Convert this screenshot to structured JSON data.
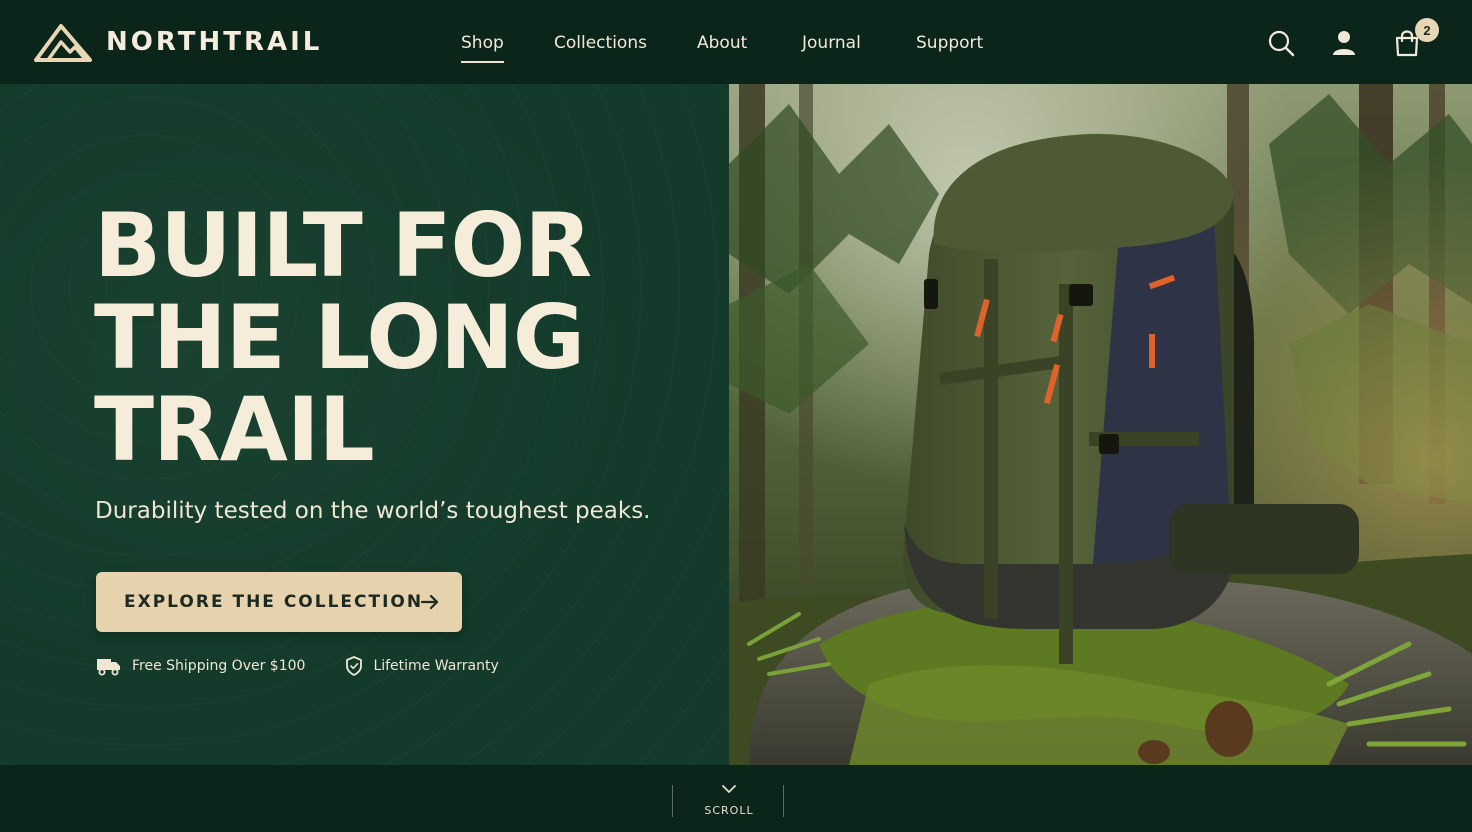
{
  "brand": {
    "name": "NORTHTRAIL",
    "logo_icon": "mountain-logo-icon"
  },
  "nav": {
    "items": [
      {
        "label": "Shop",
        "active": true
      },
      {
        "label": "Collections",
        "active": false
      },
      {
        "label": "About",
        "active": false
      },
      {
        "label": "Journal",
        "active": false
      },
      {
        "label": "Support",
        "active": false
      }
    ]
  },
  "header_icons": {
    "search": "search-icon",
    "account": "user-icon",
    "cart": "shopping-bag-icon",
    "cart_count": "2"
  },
  "hero": {
    "headline": "BUILT FOR\nTHE LONG\nTRAIL",
    "subhead": "Durability tested on the world’s toughest peaks.",
    "cta_label": "EXPLORE THE COLLECTION",
    "cta_icon": "arrow-right-icon",
    "perks": [
      {
        "icon": "truck-icon",
        "label": "Free Shipping Over $100"
      },
      {
        "icon": "shield-icon",
        "label": "Lifetime Warranty"
      }
    ]
  },
  "scroll": {
    "label": "SCROLL",
    "icon": "chevron-down-icon"
  },
  "colors": {
    "header_bg": "#0c251b",
    "hero_bg": "#133a2a",
    "cream": "#f5ecda",
    "cta_bg": "#e6d2ac",
    "accent_orange": "#e0622a"
  }
}
